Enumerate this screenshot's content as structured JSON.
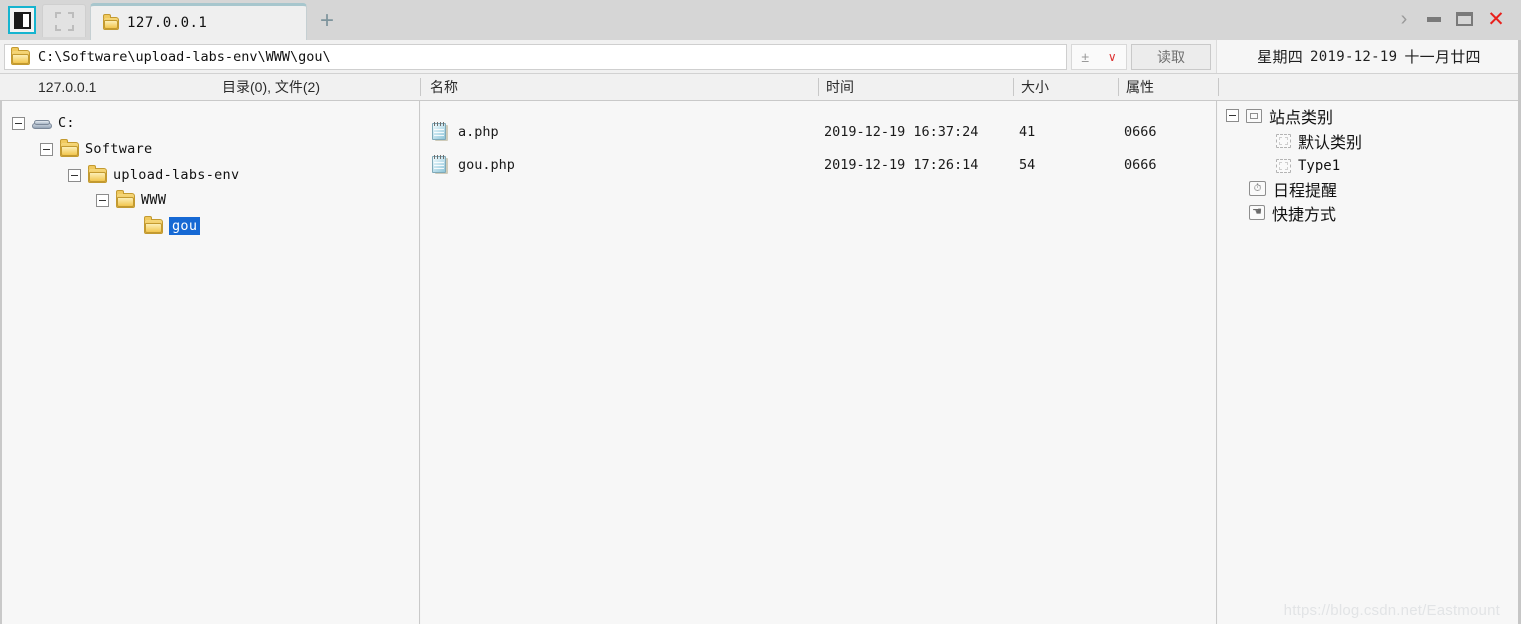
{
  "window": {
    "controls": {
      "more_label": "›",
      "minimize_label": "",
      "maximize_label": "",
      "close_label": "✕"
    }
  },
  "tabbar": {
    "panel_toggle_name": "panel-toggle",
    "placeholder_tab_name": "dashed-placeholder-tab",
    "active_tab_label": "127.0.0.1",
    "new_tab_label": "+"
  },
  "addressbar": {
    "path": "C:\\Software\\upload-labs-env\\WWW\\gou\\",
    "plus_minus_label": "±",
    "chevron_label": "∨",
    "read_button_label": "读取",
    "date": {
      "weekday": "星期四",
      "gregorian": "2019-12-19",
      "lunar": "十一月廿四"
    }
  },
  "columns": {
    "host": "127.0.0.1",
    "counts": "目录(0), 文件(2)",
    "name": "名称",
    "time": "时间",
    "size": "大小",
    "attr": "属性"
  },
  "tree": {
    "nodes": [
      {
        "label": "C:",
        "icon": "drive-icon",
        "depth": 0,
        "expanded": true,
        "selected": false
      },
      {
        "label": "Software",
        "icon": "folder-icon",
        "depth": 1,
        "expanded": true,
        "selected": false
      },
      {
        "label": "upload-labs-env",
        "icon": "folder-icon",
        "depth": 2,
        "expanded": true,
        "selected": false
      },
      {
        "label": "WWW",
        "icon": "folder-icon",
        "depth": 3,
        "expanded": true,
        "selected": false
      },
      {
        "label": "gou",
        "icon": "folder-icon",
        "depth": 4,
        "expanded": false,
        "selected": true
      }
    ]
  },
  "files": {
    "rows": [
      {
        "name": "a.php",
        "icon": "text-file-icon",
        "time": "2019-12-19  16:37:24",
        "size": "41",
        "attr": "0666"
      },
      {
        "name": "gou.php",
        "icon": "text-file-icon",
        "time": "2019-12-19  17:26:14",
        "size": "54",
        "attr": "0666"
      }
    ]
  },
  "sitepanel": {
    "nodes": [
      {
        "label": "站点类别",
        "icon": "site-category-icon",
        "depth": 0,
        "expanded": true,
        "mono": false
      },
      {
        "label": "默认类别",
        "icon": "dashed-square-icon",
        "depth": 1,
        "expanded": false,
        "mono": false
      },
      {
        "label": "Type1",
        "icon": "dashed-square-icon",
        "depth": 1,
        "expanded": false,
        "mono": true
      },
      {
        "label": "日程提醒",
        "icon": "clock-icon",
        "depth": 0,
        "expanded": false,
        "mono": false
      },
      {
        "label": "快捷方式",
        "icon": "hand-pointer-icon",
        "depth": 0,
        "expanded": false,
        "mono": false
      }
    ]
  },
  "watermark": {
    "text": "https://blog.csdn.net/Eastmount"
  },
  "colors": {
    "selection_blue": "#1669d4",
    "accent_teal": "#16b4cf",
    "close_red": "#e8201c",
    "chrome_gray": "#d6d6d6",
    "panel_bg": "#f7f7f7"
  }
}
